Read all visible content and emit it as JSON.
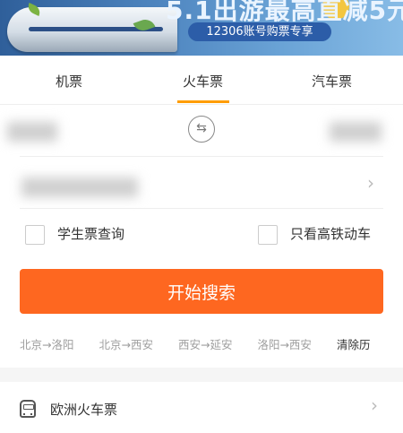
{
  "banner": {
    "title": "5.1出游最高直减5元",
    "subtitle": "12306账号购票专享"
  },
  "tabs": [
    {
      "label": "机票",
      "active": false
    },
    {
      "label": "火车票",
      "active": true
    },
    {
      "label": "汽车票",
      "active": false
    }
  ],
  "accent_color": "#fe6720",
  "tab_indicator_color": "#ff9d00",
  "route": {
    "swap_icon": "swap-icon"
  },
  "options": {
    "student": "学生票查询",
    "high_speed": "只看高铁动车"
  },
  "search_button": "开始搜索",
  "history": [
    "北京→洛阳",
    "北京→西安",
    "西安→延安",
    "洛阳→西安"
  ],
  "history_clear": "清除历",
  "euro_train": {
    "label": "欧洲火车票",
    "icon": "train-icon"
  }
}
